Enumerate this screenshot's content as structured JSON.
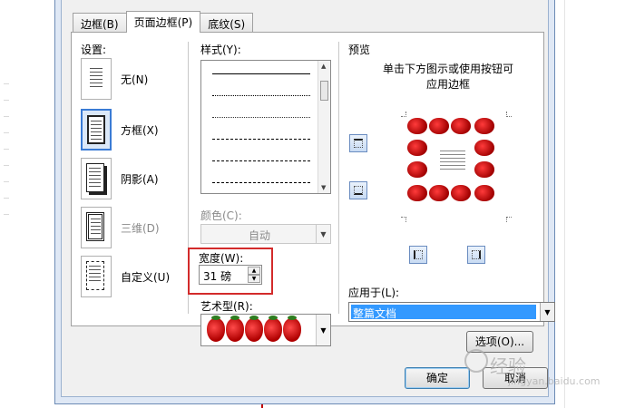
{
  "tabs": [
    {
      "label": "边框(B)",
      "active": false
    },
    {
      "label": "页面边框(P)",
      "active": true
    },
    {
      "label": "底纹(S)",
      "active": false
    }
  ],
  "settings": {
    "title": "设置:",
    "items": [
      {
        "label": "无(N)",
        "selected": false
      },
      {
        "label": "方框(X)",
        "selected": true
      },
      {
        "label": "阴影(A)",
        "selected": false
      },
      {
        "label": "三维(D)",
        "selected": false
      },
      {
        "label": "自定义(U)",
        "selected": false
      }
    ]
  },
  "style": {
    "title": "样式(Y):",
    "line_styles": [
      "solid",
      "dotted",
      "dotted-fine",
      "dashed",
      "dash-dot",
      "dash-dot-dot"
    ]
  },
  "color": {
    "label": "颜色(C):",
    "value": "自动"
  },
  "width": {
    "label": "宽度(W):",
    "value": "31 磅"
  },
  "art": {
    "label": "艺术型(R):"
  },
  "preview": {
    "title": "预览",
    "hint_line1": "单击下方图示或使用按钮可",
    "hint_line2": "应用边框"
  },
  "apply_to": {
    "label": "应用于(L):",
    "value": "整篇文档"
  },
  "buttons": {
    "options": "选项(O)...",
    "ok": "确定",
    "cancel": "取消"
  },
  "watermark": {
    "main": "经验",
    "sub": "jingyan.baidu.com"
  },
  "colors": {
    "accent": "#3399ff",
    "highlight_box": "#d32b2b",
    "dialog_bg": "#f0f0f0"
  }
}
